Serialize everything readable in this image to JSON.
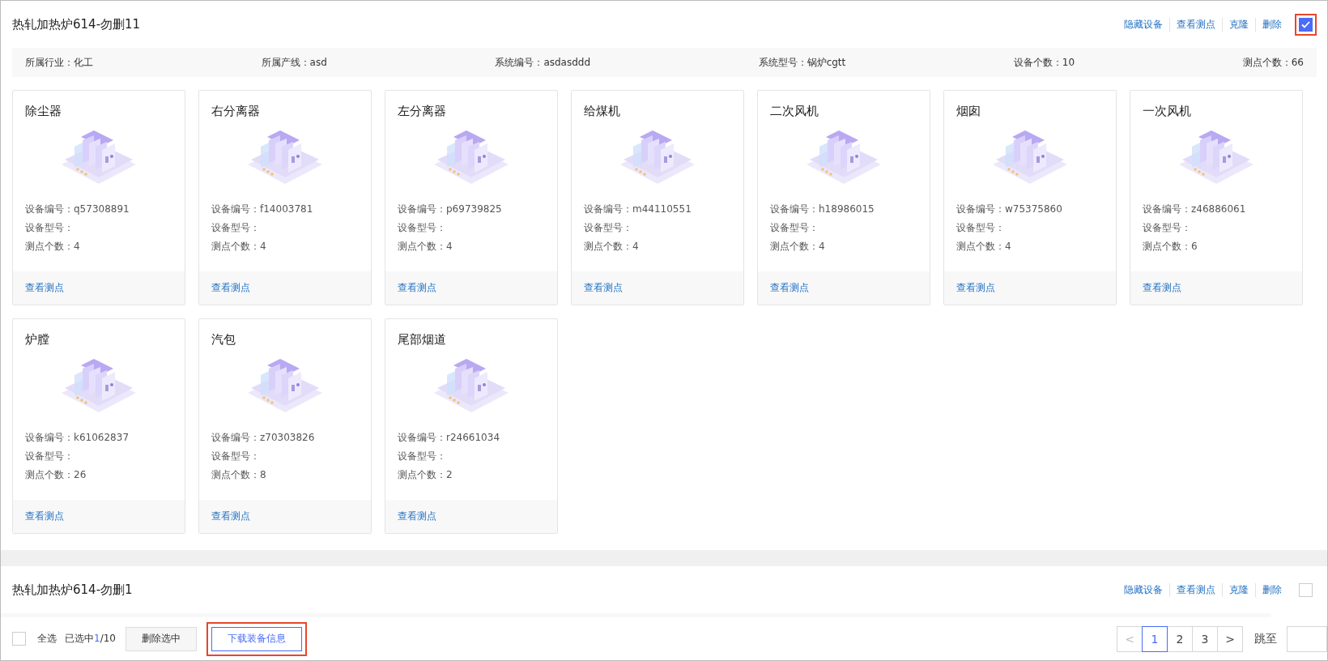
{
  "sections": [
    {
      "title": "热轧加热炉614-勿删11",
      "actions": [
        "隐藏设备",
        "查看测点",
        "克隆",
        "删除"
      ],
      "checked": true,
      "highlighted": true,
      "info": [
        "所属行业：化工",
        "所属产线：asd",
        "系统编号：asdasddd",
        "系统型号：锅炉cgtt",
        "设备个数：10",
        "测点个数：66"
      ],
      "devices": [
        {
          "name": "除尘器",
          "code": "设备编号：q57308891",
          "model": "设备型号：",
          "points": "测点个数：4",
          "link": "查看测点"
        },
        {
          "name": "右分离器",
          "code": "设备编号：f14003781",
          "model": "设备型号：",
          "points": "测点个数：4",
          "link": "查看测点"
        },
        {
          "name": "左分离器",
          "code": "设备编号：p69739825",
          "model": "设备型号：",
          "points": "测点个数：4",
          "link": "查看测点"
        },
        {
          "name": "给煤机",
          "code": "设备编号：m44110551",
          "model": "设备型号：",
          "points": "测点个数：4",
          "link": "查看测点"
        },
        {
          "name": "二次风机",
          "code": "设备编号：h18986015",
          "model": "设备型号：",
          "points": "测点个数：4",
          "link": "查看测点"
        },
        {
          "name": "烟囱",
          "code": "设备编号：w75375860",
          "model": "设备型号：",
          "points": "测点个数：4",
          "link": "查看测点"
        },
        {
          "name": "一次风机",
          "code": "设备编号：z46886061",
          "model": "设备型号：",
          "points": "测点个数：6",
          "link": "查看测点"
        },
        {
          "name": "炉膛",
          "code": "设备编号：k61062837",
          "model": "设备型号：",
          "points": "测点个数：26",
          "link": "查看测点"
        },
        {
          "name": "汽包",
          "code": "设备编号：z70303826",
          "model": "设备型号：",
          "points": "测点个数：8",
          "link": "查看测点"
        },
        {
          "name": "尾部烟道",
          "code": "设备编号：r24661034",
          "model": "设备型号：",
          "points": "测点个数：2",
          "link": "查看测点"
        }
      ]
    },
    {
      "title": "热轧加热炉614-勿删1",
      "actions": [
        "隐藏设备",
        "查看测点",
        "克隆",
        "删除"
      ],
      "checked": false,
      "highlighted": false
    }
  ],
  "footer": {
    "select_all": {
      "label": "全选",
      "checked": false
    },
    "selected_prefix": "已选中",
    "selected_count": "1",
    "selected_total": "/10",
    "buttons": [
      {
        "label": "删除选中",
        "kind": "plain",
        "highlighted": false
      },
      {
        "label": "下载装备信息",
        "kind": "primary",
        "highlighted": true
      }
    ],
    "pagination": {
      "prev": "<",
      "pages": [
        {
          "label": "1",
          "selected": true
        },
        {
          "label": "2",
          "selected": false
        },
        {
          "label": "3",
          "selected": false
        }
      ],
      "next": ">",
      "jump_label": "跳至"
    }
  }
}
